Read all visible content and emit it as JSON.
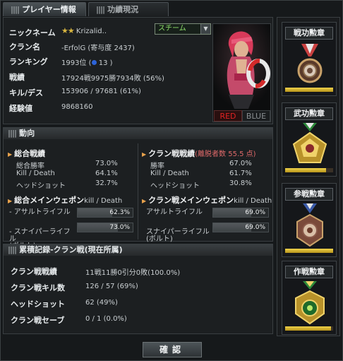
{
  "tabs": [
    {
      "label": "プレイヤー情報",
      "active": true
    },
    {
      "label": "功績現況",
      "active": false
    }
  ],
  "profile": {
    "nickname_label": "ニックネーム",
    "nickname_value": "Krizalid..",
    "nickname_rank_stars": "★★",
    "clan_label": "クラン名",
    "clan_value": "-ErfolG (寄与度 2437)",
    "ranking_label": "ランキング",
    "ranking_value_prefix": "1993位 (",
    "ranking_value_suffix": "13 )",
    "record_label": "戦績",
    "record_value": "17924戦9975勝7934敗 (56%)",
    "kd_label": "キル/デス",
    "kd_value": "153906 / 97681 (61%)",
    "exp_label": "経験値",
    "exp_value": "9868160",
    "team_select": "スチーム",
    "team_red": "RED",
    "team_blue": "BLUE",
    "colors": {
      "red": "#e02222",
      "blue": "#8a8f92"
    }
  },
  "dongkou": {
    "title": "動向",
    "left": {
      "head": "総合戦績",
      "rows": [
        {
          "k": "総合勝率",
          "v": "73.0%"
        },
        {
          "k": "Kill / Death",
          "v": "64.1%"
        },
        {
          "k": "ヘッドショット",
          "v": "32.7%"
        }
      ],
      "weapon_head": "総合メインウェポン",
      "weapon_head_suffix": "kill / Death",
      "weapons": [
        {
          "name": "- アサルトライフル",
          "value": "62.3%",
          "ratio": 0.623
        },
        {
          "name": "- スナイパーライフル\n(ボルト)",
          "value": "73.0%",
          "ratio": 0.73
        }
      ]
    },
    "right": {
      "head": "クラン戦戦績",
      "head_note": "(離脱者数 55.5 点)",
      "rows": [
        {
          "k": "勝率",
          "v": "67.0%"
        },
        {
          "k": "Kill / Death",
          "v": "61.7%"
        },
        {
          "k": "ヘッドショット",
          "v": "30.8%"
        }
      ],
      "weapon_head": "クラン戦メインウェポン",
      "weapon_head_suffix": "kill / Death",
      "weapons": [
        {
          "name": "アサルトライフル",
          "value": "69.0%",
          "ratio": 0.69
        },
        {
          "name": "スナイパーライフル\n(ボルト)",
          "value": "69.0%",
          "ratio": 0.69
        }
      ]
    }
  },
  "records": {
    "title": "累積記録-クラン戦(現在所属)",
    "rows": [
      {
        "k": "クラン戦戦績",
        "v": "11戦11勝0引分0敗(100.0%)"
      },
      {
        "k": "クラン戦キル数",
        "v": "126 / 57 (69%)"
      },
      {
        "k": "ヘッドショット",
        "v": "62 (49%)"
      },
      {
        "k": "クラン戦セーブ",
        "v": "0 / 1 (0.0%)"
      }
    ]
  },
  "medals": [
    {
      "title": "戦功勲章",
      "ratio": 1.0,
      "icon": "service-medal-icon"
    },
    {
      "title": "武功勲章",
      "ratio": 0.85,
      "icon": "valor-medal-icon"
    },
    {
      "title": "参戦勲章",
      "ratio": 1.0,
      "icon": "participation-medal-icon"
    },
    {
      "title": "作戦勲章",
      "ratio": 0.95,
      "icon": "operation-medal-icon"
    }
  ],
  "confirm_label": "確認"
}
